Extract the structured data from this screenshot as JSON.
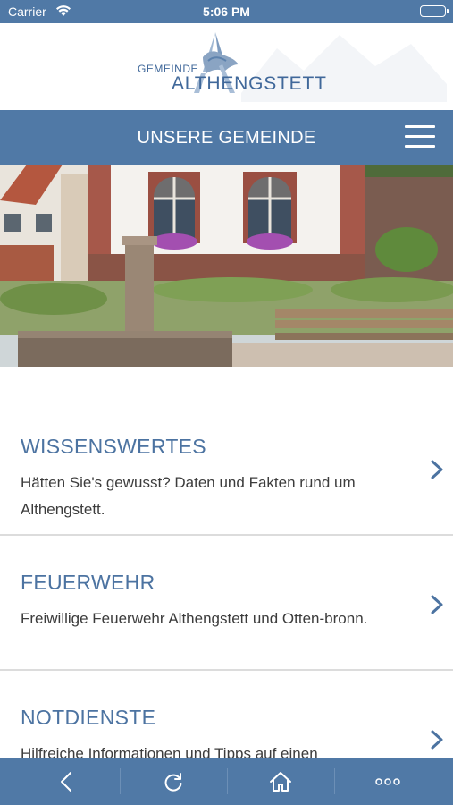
{
  "status_bar": {
    "carrier": "Carrier",
    "time": "5:06 PM",
    "wifi_icon": "wifi-icon",
    "battery_icon": "battery-icon"
  },
  "logo": {
    "line1": "GEMEINDE",
    "line2": "ALTHENGSTETT"
  },
  "nav": {
    "title": "UNSERE GEMEINDE",
    "menu_icon": "hamburger-menu-icon"
  },
  "list": [
    {
      "title": "WISSENSWERTES",
      "description": "Hätten Sie's gewusst? Daten und Fakten rund um Althengstett."
    },
    {
      "title": "FEUERWEHR",
      "description": "Freiwillige Feuerwehr Althengstett und Otten-bronn."
    },
    {
      "title": "NOTDIENSTE",
      "description": "Hilfreiche Informationen und Tipps auf einen"
    }
  ],
  "toolbar": {
    "items": [
      "back-icon",
      "reload-icon",
      "home-icon",
      "more-icon"
    ]
  },
  "colors": {
    "primary": "#5079a6",
    "title_text": "#4c73a1",
    "body_text": "#3c3c3c",
    "divider": "#dcdcdc"
  }
}
